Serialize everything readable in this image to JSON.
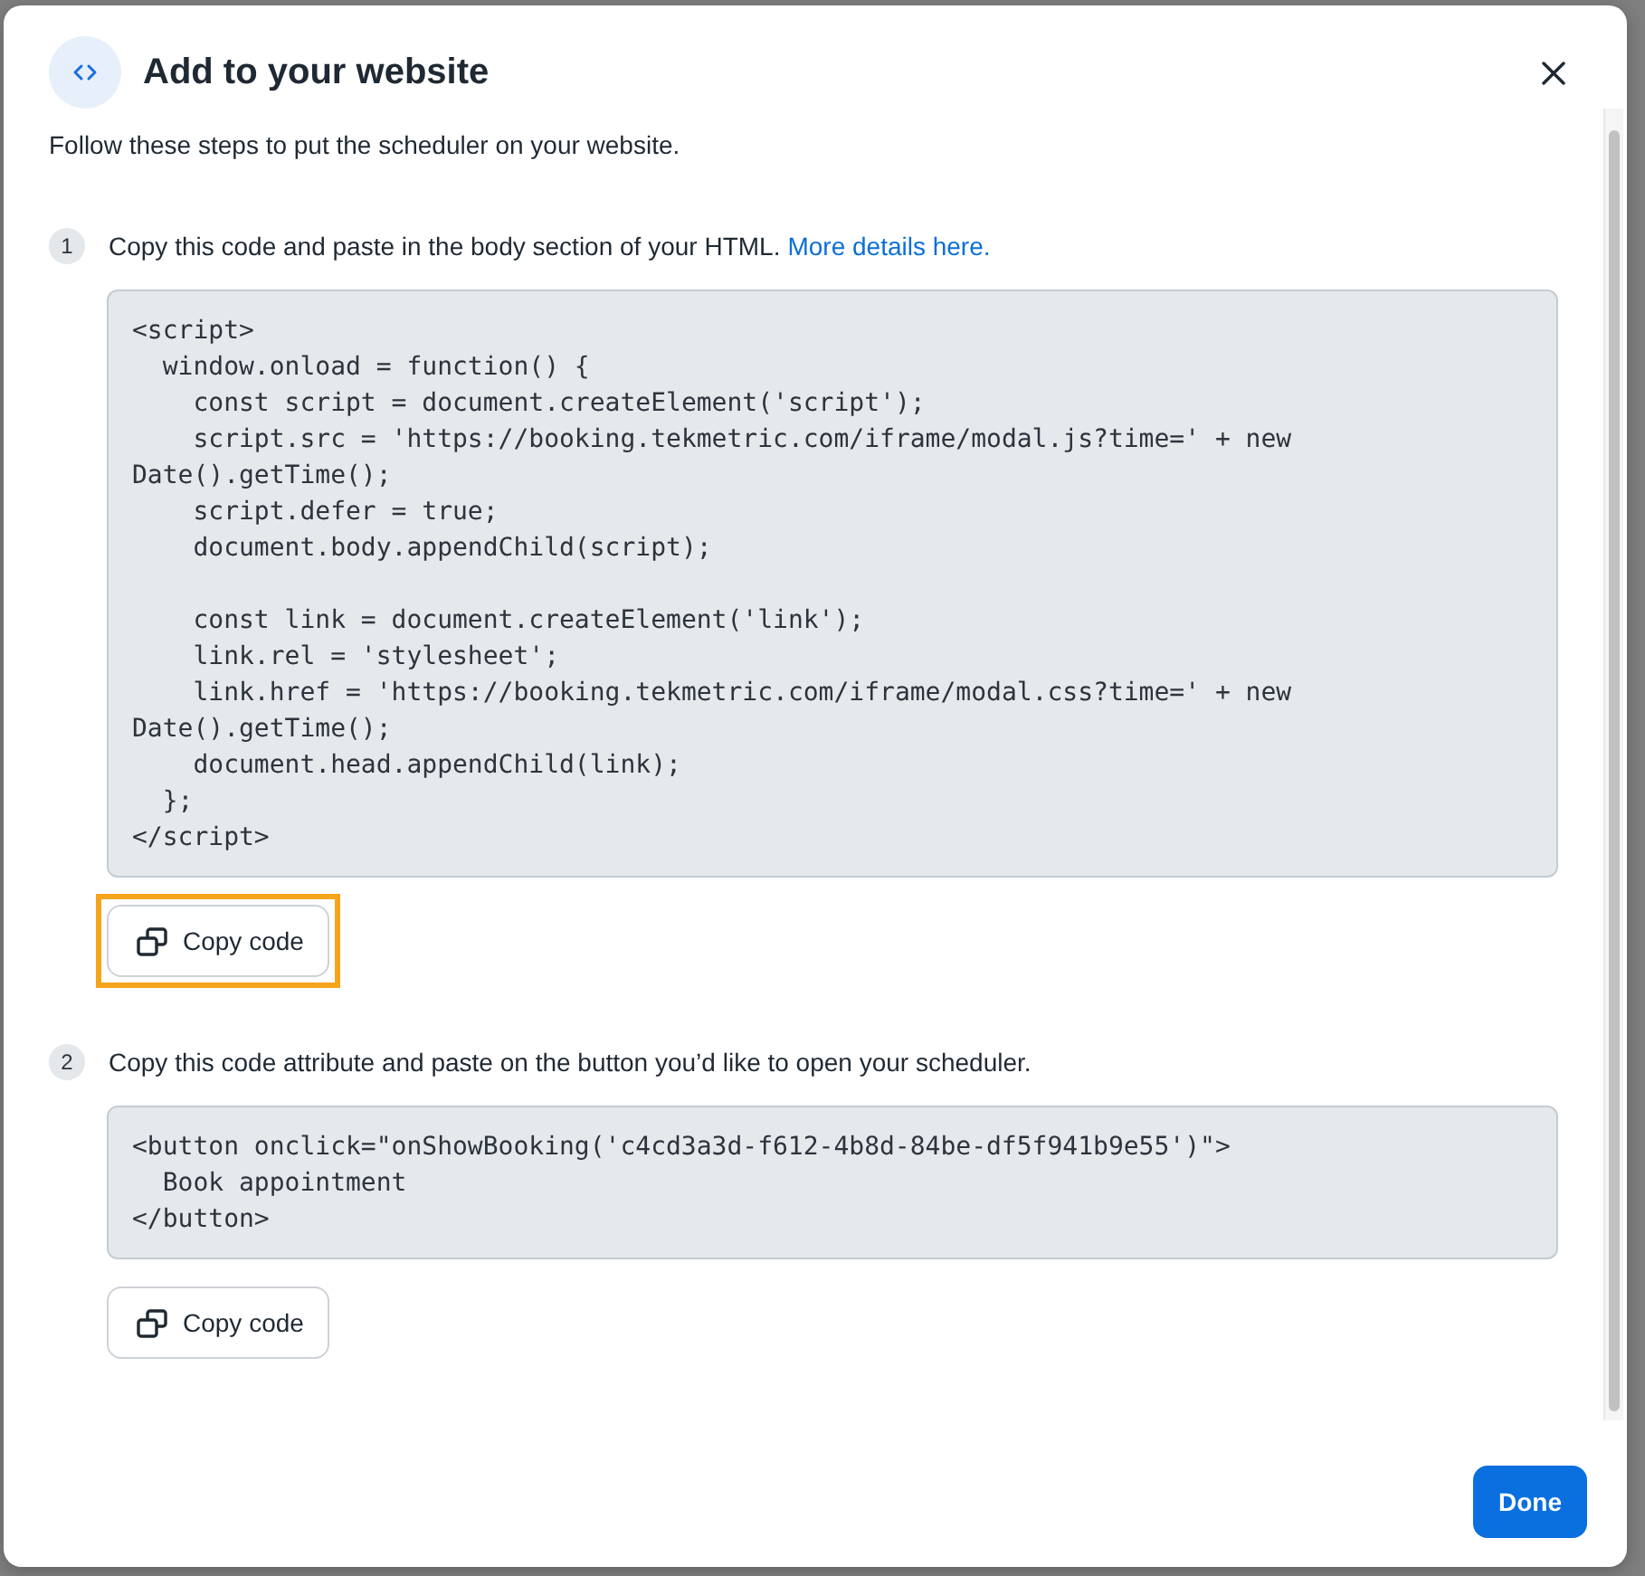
{
  "dialog": {
    "title": "Add to your website",
    "intro": "Follow these steps to put the scheduler on your website."
  },
  "steps": [
    {
      "number": "1",
      "text": "Copy this code and paste in the body section of your HTML.",
      "link": "More details here.",
      "code": "<script>\n  window.onload = function() {\n    const script = document.createElement('script');\n    script.src = 'https://booking.tekmetric.com/iframe/modal.js?time=' + new Date().getTime();\n    script.defer = true;\n    document.body.appendChild(script);\n\n    const link = document.createElement('link');\n    link.rel = 'stylesheet';\n    link.href = 'https://booking.tekmetric.com/iframe/modal.css?time=' + new Date().getTime();\n    document.head.appendChild(link);\n  };\n</script>",
      "copy_button": {
        "label": "Copy code",
        "focused": true
      }
    },
    {
      "number": "2",
      "text": "Copy this code attribute and paste on the button you’d like to open your scheduler.",
      "code": "<button onclick=\"onShowBooking('c4cd3a3d-f612-4b8d-84be-df5f941b9e55')\">\n  Book appointment\n</button>",
      "copy_button": {
        "label": "Copy code",
        "focused": false
      }
    }
  ],
  "footer": {
    "done_button": "Done"
  }
}
